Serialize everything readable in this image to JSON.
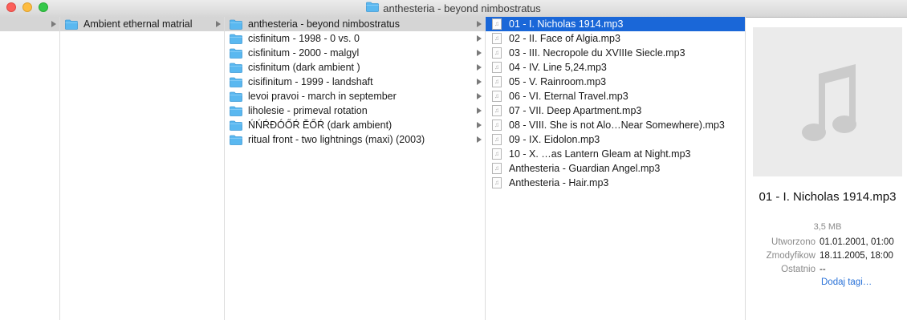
{
  "window": {
    "title": "anthesteria - beyond nimbostratus"
  },
  "column1": {
    "items": [
      {
        "label": "Ambient ethernal matrial",
        "kind": "folder",
        "has_children": true,
        "selected": "gray"
      }
    ]
  },
  "column2": {
    "items": [
      {
        "label": "anthesteria - beyond nimbostratus",
        "kind": "folder",
        "has_children": true,
        "selected": "gray"
      },
      {
        "label": "cisfinitum - 1998 - 0 vs. 0",
        "kind": "folder",
        "has_children": true
      },
      {
        "label": "cisfinitum - 2000 - malgyl",
        "kind": "folder",
        "has_children": true
      },
      {
        "label": "cisfinitum (dark ambient )",
        "kind": "folder",
        "has_children": true
      },
      {
        "label": "cisifinitum - 1999 - landshaft",
        "kind": "folder",
        "has_children": true
      },
      {
        "label": "levoi pravoi - march in september",
        "kind": "folder",
        "has_children": true
      },
      {
        "label": "liholesie - primeval rotation",
        "kind": "folder",
        "has_children": true
      },
      {
        "label": "ŃŃŔĐÓŐŔ ĔŐŔ (dark ambient)",
        "kind": "folder",
        "has_children": true
      },
      {
        "label": "ritual front - two lightnings (maxi) (2003)",
        "kind": "folder",
        "has_children": true
      }
    ]
  },
  "column3": {
    "items": [
      {
        "label": "01 - I. Nicholas 1914.mp3",
        "kind": "audio",
        "selected": "blue"
      },
      {
        "label": "02 - II. Face of Algia.mp3",
        "kind": "audio"
      },
      {
        "label": "03 - III. Necropole du XVIIIe Siecle.mp3",
        "kind": "audio"
      },
      {
        "label": "04 - IV. Line 5,24.mp3",
        "kind": "audio"
      },
      {
        "label": "05 - V. Rainroom.mp3",
        "kind": "audio"
      },
      {
        "label": "06 - VI. Eternal Travel.mp3",
        "kind": "audio"
      },
      {
        "label": "07 - VII. Deep Apartment.mp3",
        "kind": "audio"
      },
      {
        "label": "08 - VIII. She is not Alo…Near Somewhere).mp3",
        "kind": "audio"
      },
      {
        "label": "09 - IX. Eidolon.mp3",
        "kind": "audio"
      },
      {
        "label": "10 - X. …as Lantern Gleam at Night.mp3",
        "kind": "audio"
      },
      {
        "label": "Anthesteria - Guardian Angel.mp3",
        "kind": "audio"
      },
      {
        "label": "Anthesteria - Hair.mp3",
        "kind": "audio"
      }
    ]
  },
  "preview": {
    "icon": "music-note-icon",
    "name": "01 - I. Nicholas 1914.mp3",
    "size": "3,5 MB",
    "created_label": "Utworzono",
    "created_value": "01.01.2001, 01:00",
    "modified_label": "Zmodyfikow",
    "modified_value": "18.11.2005, 18:00",
    "opened_label": "Ostatnio",
    "opened_value": "--",
    "add_tags": "Dodaj tagi…"
  },
  "colors": {
    "selection_blue": "#1a67d8",
    "selection_gray": "#d5d5d5",
    "folder_blue": "#5ab8f0",
    "link_blue": "#2a72d8"
  }
}
